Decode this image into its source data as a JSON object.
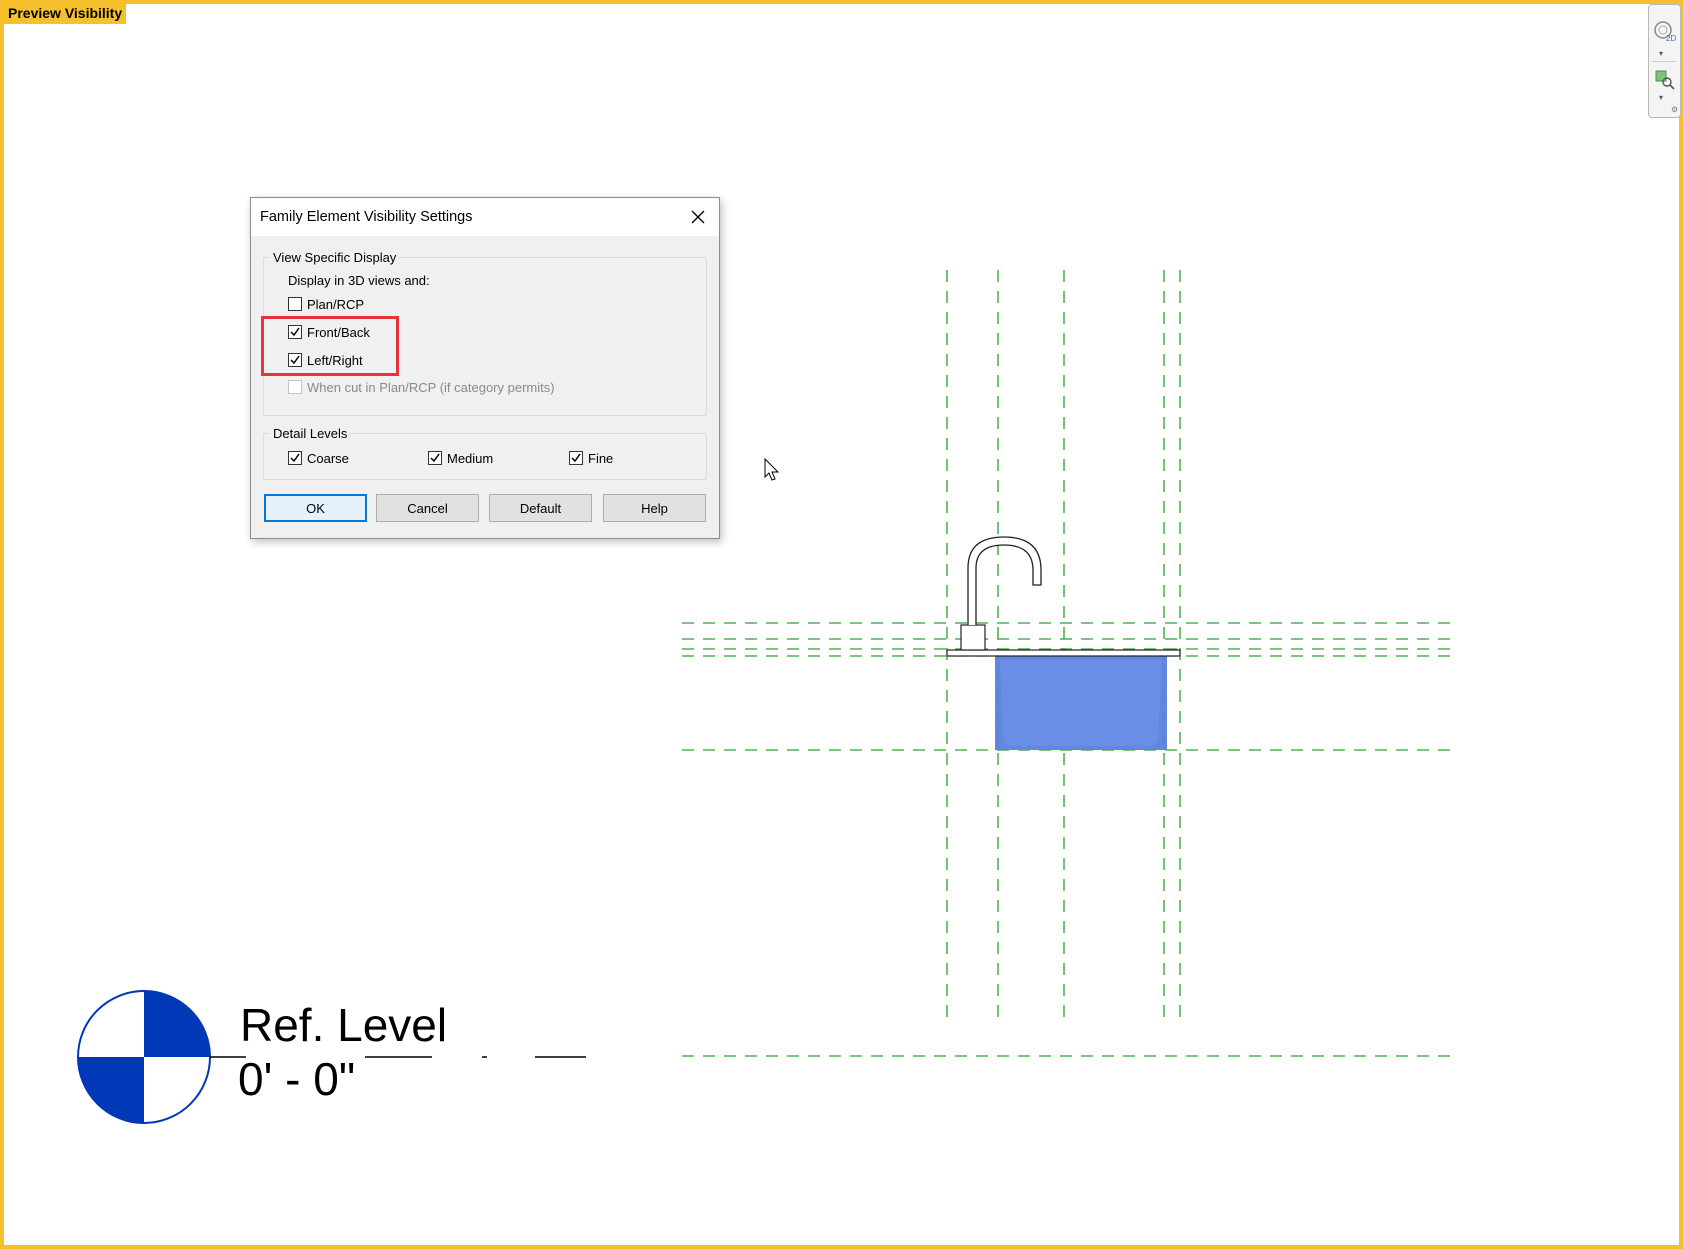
{
  "preview_label": "Preview Visibility",
  "colors": {
    "frame": "#f5c02c",
    "reference_plane": "#2aa32a",
    "sink_fill": "#5b7fdc",
    "level_marker": "#0038b8",
    "highlight": "#e8323c"
  },
  "view_tools": {
    "icons": [
      "view-cube-2d-icon",
      "zoom-region-icon"
    ]
  },
  "dialog": {
    "title": "Family Element Visibility Settings",
    "view_specific": {
      "legend": "View Specific Display",
      "subtitle": "Display in 3D views and:",
      "options": [
        {
          "label": "Plan/RCP",
          "checked": false,
          "disabled": false
        },
        {
          "label": "Front/Back",
          "checked": true,
          "disabled": false
        },
        {
          "label": "Left/Right",
          "checked": true,
          "disabled": false
        },
        {
          "label": "When cut in Plan/RCP (if category permits)",
          "checked": false,
          "disabled": true
        }
      ]
    },
    "detail_levels": {
      "legend": "Detail Levels",
      "options": [
        {
          "label": "Coarse",
          "checked": true
        },
        {
          "label": "Medium",
          "checked": true
        },
        {
          "label": "Fine",
          "checked": true
        }
      ]
    },
    "buttons": {
      "ok": "OK",
      "cancel": "Cancel",
      "default": "Default",
      "help": "Help"
    }
  },
  "level": {
    "name": "Ref. Level",
    "elevation": "0' - 0\""
  }
}
